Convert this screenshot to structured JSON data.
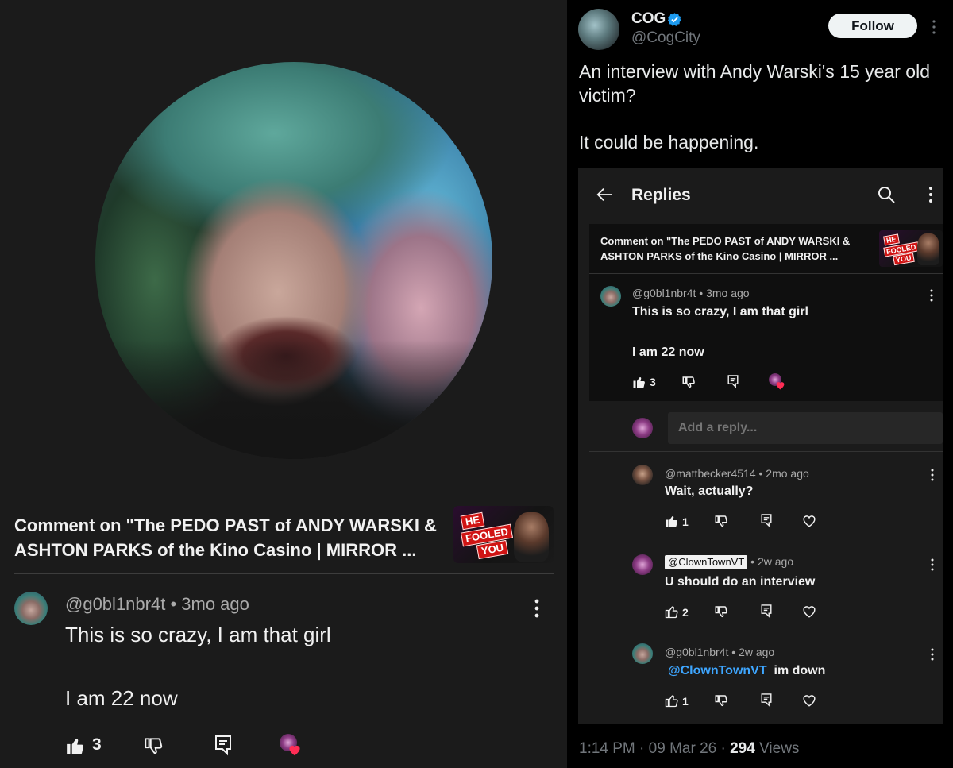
{
  "left": {
    "comment_header": "Comment on \"The PEDO PAST of ANDY WARSKI & ASHTON PARKS of the Kino Casino | MIRROR ...",
    "thumbnail_badge": [
      "HE",
      "FOOLED",
      "YOU"
    ],
    "comment": {
      "handle": "@g0bl1nbr4t",
      "age": "3mo ago",
      "line1": "This is so crazy, I am that girl",
      "line2": "I am 22 now",
      "likes": "3"
    }
  },
  "right": {
    "author": {
      "name": "COG",
      "handle": "@CogCity",
      "verified": true
    },
    "follow_label": "Follow",
    "tweet_line1": "An interview with Andy Warski's 15 year old victim?",
    "tweet_line2": "It could be happening.",
    "embed": {
      "title": "Replies",
      "comment_header": "Comment on \"The PEDO PAST of ANDY WARSKI & ASHTON PARKS of the Kino Casino | MIRROR ...",
      "original": {
        "handle": "@g0bl1nbr4t",
        "age": "3mo ago",
        "line1": "This is so crazy, I am that girl",
        "line2": "I am 22 now",
        "likes": "3"
      },
      "reply_placeholder": "Add a reply...",
      "replies": [
        {
          "handle": "@mattbecker4514",
          "age": "2mo ago",
          "text": "Wait, actually?",
          "likes": "1"
        },
        {
          "handle": "@ClownTownVT",
          "age": "2w ago",
          "text": "U should do an interview",
          "likes": "2"
        },
        {
          "handle": "@g0bl1nbr4t",
          "age": "2w ago",
          "mention": "@ClownTownVT",
          "text": "im down",
          "likes": "1"
        }
      ]
    },
    "footer": {
      "time": "1:14 PM",
      "date": "09 Mar 26",
      "views": "294",
      "views_label": "Views"
    }
  },
  "colors": {
    "left_bg": "#1b1b1b",
    "right_bg": "#000000",
    "link_blue": "#3ea6ff",
    "verified_blue": "#1d9bf0",
    "heart_red": "#ff2d55"
  }
}
